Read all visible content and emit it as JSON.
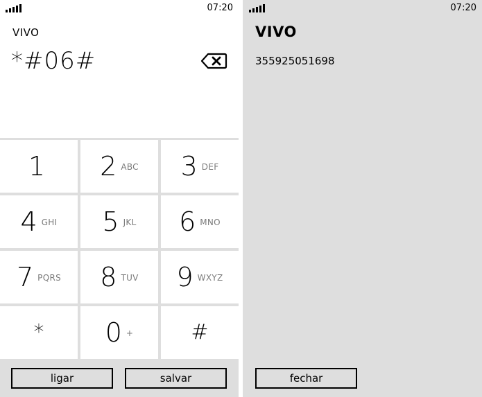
{
  "status_bar": {
    "time": "07:20"
  },
  "dialer": {
    "carrier": "VIVO",
    "input_value": "*#06#",
    "keys": [
      {
        "digit": "1",
        "letters": ""
      },
      {
        "digit": "2",
        "letters": "ABC"
      },
      {
        "digit": "3",
        "letters": "DEF"
      },
      {
        "digit": "4",
        "letters": "GHI"
      },
      {
        "digit": "5",
        "letters": "JKL"
      },
      {
        "digit": "6",
        "letters": "MNO"
      },
      {
        "digit": "7",
        "letters": "PQRS"
      },
      {
        "digit": "8",
        "letters": "TUV"
      },
      {
        "digit": "9",
        "letters": "WXYZ"
      },
      {
        "digit": "*",
        "letters": ""
      },
      {
        "digit": "0",
        "letters": "+"
      },
      {
        "digit": "#",
        "letters": ""
      }
    ],
    "call_label": "ligar",
    "save_label": "salvar"
  },
  "imei_screen": {
    "carrier": "VIVO",
    "imei": "355925051698",
    "close_label": "fechar"
  },
  "icons": {
    "signal": "signal-strength-icon",
    "backspace": "backspace-icon"
  },
  "colors": {
    "keypad_background": "#dedede",
    "key_background": "#ffffff",
    "letters_text": "#7a7a7a",
    "right_background": "#dedede"
  }
}
